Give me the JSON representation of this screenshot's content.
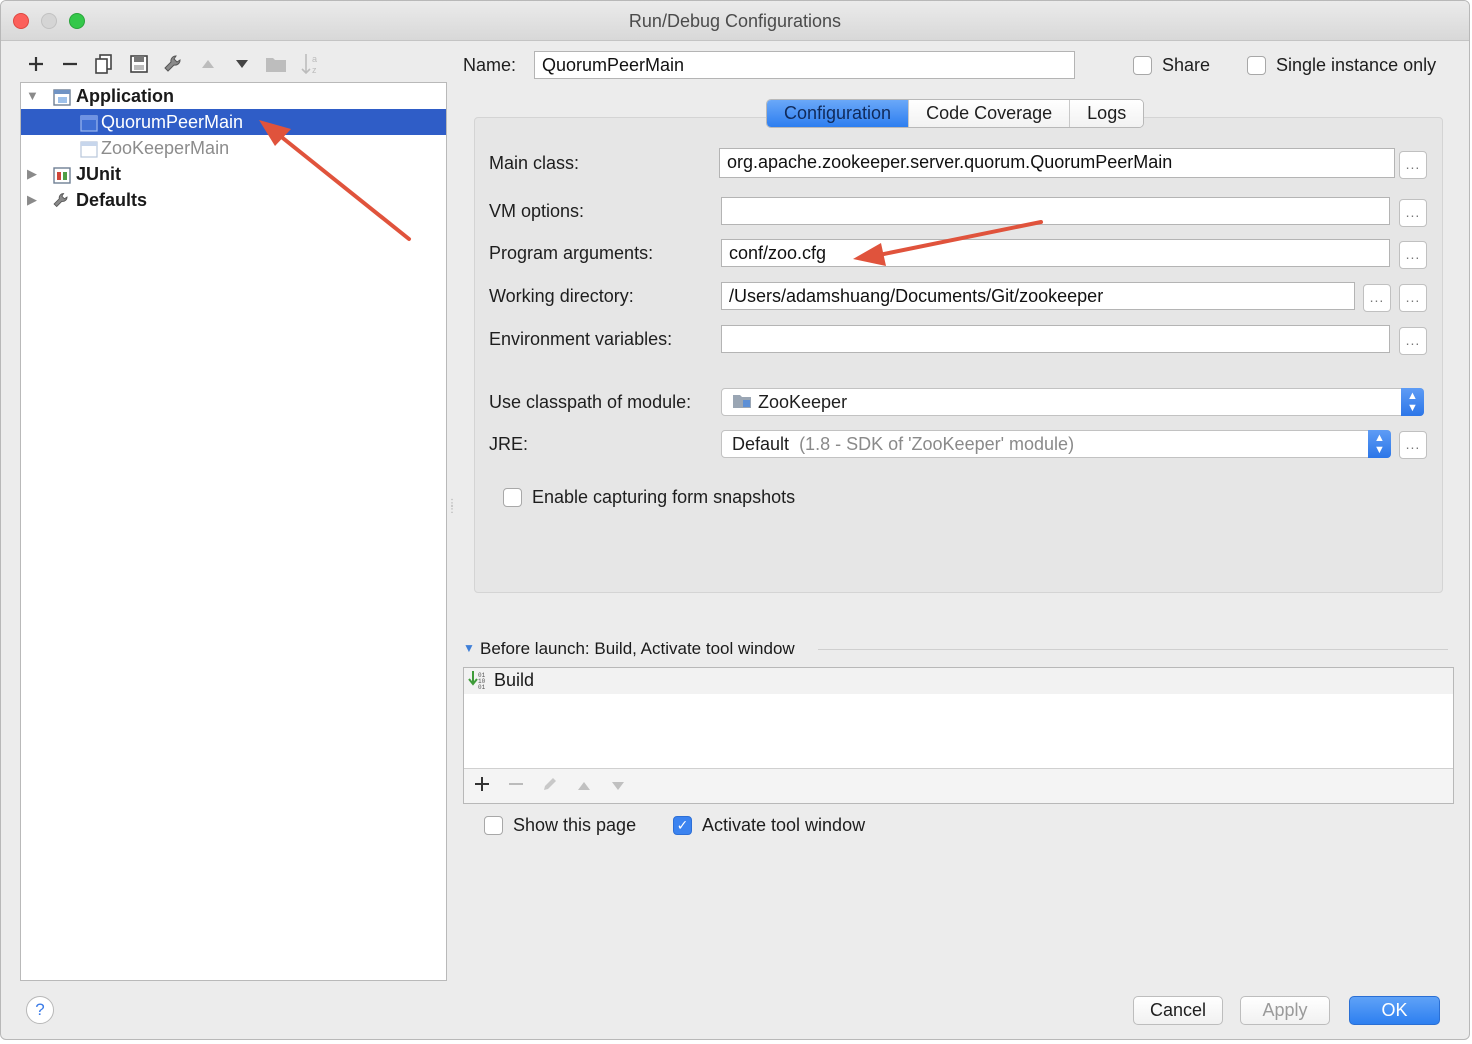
{
  "window": {
    "title": "Run/Debug Configurations"
  },
  "toolbar": {
    "icons": [
      "add-icon",
      "remove-icon",
      "copy-icon",
      "save-icon",
      "wrench-icon",
      "move-up-icon",
      "move-down-icon",
      "folder-icon",
      "sort-icon"
    ]
  },
  "tree": {
    "items": [
      {
        "label": "Application",
        "type": "group",
        "expanded": true
      },
      {
        "label": "QuorumPeerMain",
        "type": "config",
        "selected": true
      },
      {
        "label": "ZooKeeperMain",
        "type": "config",
        "selected": false
      },
      {
        "label": "JUnit",
        "type": "group",
        "expanded": false
      },
      {
        "label": "Defaults",
        "type": "group",
        "expanded": false
      }
    ]
  },
  "header": {
    "name_label": "Name:",
    "name_value": "QuorumPeerMain",
    "share_label": "Share",
    "share_checked": false,
    "single_instance_label": "Single instance only",
    "single_instance_checked": false
  },
  "tabs": [
    {
      "label": "Configuration",
      "active": true
    },
    {
      "label": "Code Coverage",
      "active": false
    },
    {
      "label": "Logs",
      "active": false
    }
  ],
  "form": {
    "main_class_label": "Main class:",
    "main_class_value": "org.apache.zookeeper.server.quorum.QuorumPeerMain",
    "vm_options_label": "VM options:",
    "vm_options_value": "",
    "program_args_label": "Program arguments:",
    "program_args_value": "conf/zoo.cfg",
    "working_dir_label": "Working directory:",
    "working_dir_value": "/Users/adamshuang/Documents/Git/zookeeper",
    "env_vars_label": "Environment variables:",
    "env_vars_value": "",
    "classpath_label": "Use classpath of module:",
    "classpath_value": "ZooKeeper",
    "jre_label": "JRE:",
    "jre_value": "Default",
    "jre_detail": "(1.8 - SDK of 'ZooKeeper' module)",
    "snapshots_label": "Enable capturing form snapshots",
    "snapshots_checked": false,
    "browse_label": "..."
  },
  "before_launch": {
    "title": "Before launch: Build, Activate tool window",
    "items": [
      "Build"
    ],
    "show_page_label": "Show this page",
    "show_page_checked": false,
    "activate_label": "Activate tool window",
    "activate_checked": true
  },
  "footer": {
    "help_label": "?",
    "cancel_label": "Cancel",
    "apply_label": "Apply",
    "ok_label": "OK"
  },
  "colors": {
    "selection": "#2f5dc7",
    "accent": "#2d7ff0",
    "annotation_arrow": "#e0533c"
  }
}
